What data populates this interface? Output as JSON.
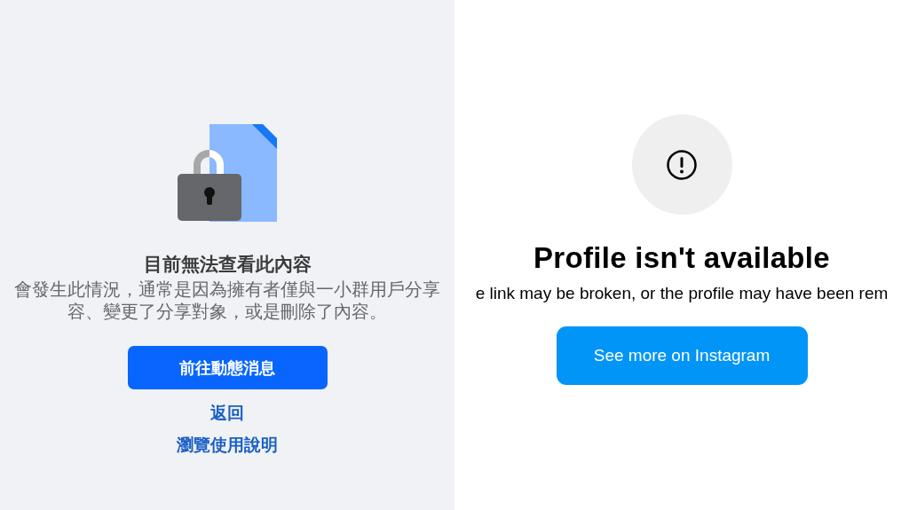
{
  "facebook_panel": {
    "title": "目前無法查看此內容",
    "message_lines": [
      "會發生此情況，通常是因為擁有者僅與一小群用戶分享",
      "容、變更了分享對象，或是刪除了內容。"
    ],
    "primary_button": "前往動態消息",
    "links": [
      "返回",
      "瀏覽使用說明"
    ]
  },
  "instagram_panel": {
    "title": "Profile isn't available",
    "message": "e link may be broken, or the profile may have been rem",
    "primary_button": "See more on Instagram"
  }
}
